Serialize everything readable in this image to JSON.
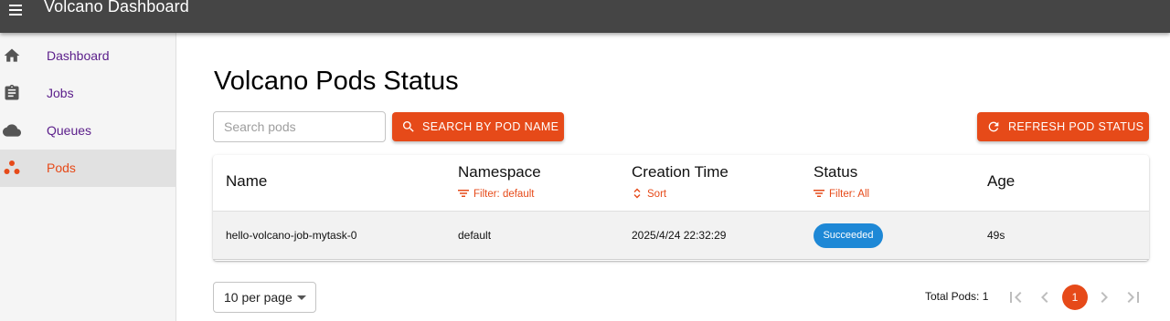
{
  "app": {
    "title": "Volcano Dashboard"
  },
  "sidebar": {
    "items": [
      {
        "label": "Dashboard",
        "icon": "home-icon"
      },
      {
        "label": "Jobs",
        "icon": "clipboard-icon"
      },
      {
        "label": "Queues",
        "icon": "cloud-icon"
      },
      {
        "label": "Pods",
        "icon": "pods-icon",
        "active": true
      }
    ]
  },
  "page": {
    "title": "Volcano Pods Status"
  },
  "search": {
    "placeholder": "Search pods",
    "value": ""
  },
  "buttons": {
    "search_label": "Search by Pod Name",
    "refresh_label": "Refresh Pod Status"
  },
  "table": {
    "headers": {
      "name": "Name",
      "namespace": "Namespace",
      "creation_time": "Creation Time",
      "status": "Status",
      "age": "Age"
    },
    "filters": {
      "namespace": "Filter: default",
      "creation_time": "Sort",
      "status": "Filter: All"
    },
    "rows": [
      {
        "name": "hello-volcano-job-mytask-0",
        "namespace": "default",
        "creation_time": "2025/4/24 22:32:29",
        "status": "Succeeded",
        "age": "49s"
      }
    ]
  },
  "pagination": {
    "per_page": "10 per page",
    "total": "Total Pods: 1",
    "current_page": "1"
  },
  "colors": {
    "accent": "#e64a19",
    "appbar": "#454545",
    "nav_text": "#5a1d8a",
    "status_succeeded": "#1e88d6"
  }
}
